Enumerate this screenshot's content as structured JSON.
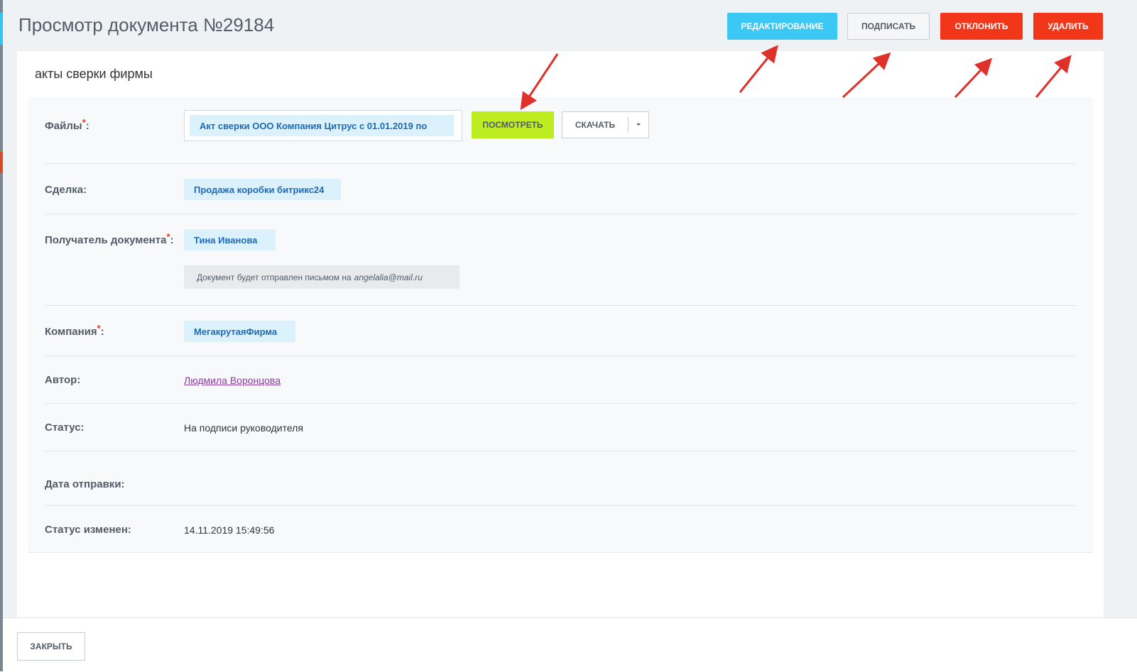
{
  "header": {
    "title": "Просмотр документа №29184",
    "buttons": {
      "edit": "РЕДАКТИРОВАНИЕ",
      "sign": "ПОДПИСАТЬ",
      "reject": "ОТКЛОНИТЬ",
      "delete": "УДАЛИТЬ"
    }
  },
  "card": {
    "subtitle": "акты сверки фирмы"
  },
  "form": {
    "files": {
      "label": "Файлы",
      "required": "*",
      "colon": ":",
      "file_name": "Акт сверки ООО Компания Цитрус с 01.01.2019 по",
      "view_button": "ПОСМОТРЕТЬ",
      "download_button": "СКАЧАТЬ"
    },
    "deal": {
      "label": "Сделка:",
      "value": "Продажа коробки битрикс24"
    },
    "recipient": {
      "label": "Получатель документа",
      "required": "*",
      "colon": ":",
      "value": "Тина Иванова",
      "note_prefix": "Документ будет отправлен письмом на",
      "note_email": "angelalia@mail.ru"
    },
    "company": {
      "label": "Компания",
      "required": "*",
      "colon": ":",
      "value": "МегакрутаяФирма"
    },
    "author": {
      "label": "Автор:",
      "value": "Людмила Воронцова"
    },
    "status": {
      "label": "Статус:",
      "value": "На подписи руководителя"
    },
    "send_date": {
      "label": "Дата отправки:",
      "value": ""
    },
    "status_changed": {
      "label": "Статус изменен:",
      "value": "14.11.2019 15:49:56"
    }
  },
  "footer": {
    "close_button": "ЗАКРЫТЬ"
  },
  "colors": {
    "edit_button": "#3bc8f5",
    "reject_button": "#f1361a",
    "view_button": "#bbed21",
    "annotation_arrow": "#e0302a"
  }
}
